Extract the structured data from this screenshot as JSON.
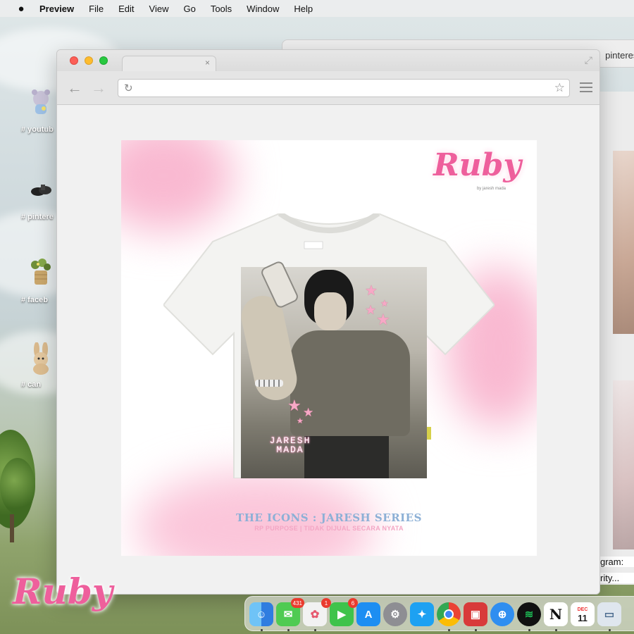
{
  "menubar": {
    "app_name": "Preview",
    "items": [
      "File",
      "Edit",
      "View",
      "Go",
      "Tools",
      "Window",
      "Help"
    ]
  },
  "desktop": {
    "icons": [
      {
        "label": "# youtub",
        "icon": "teddy-bear-sticker-icon"
      },
      {
        "label": "# pintere",
        "icon": "shoes-sticker-icon"
      },
      {
        "label": "# faceb",
        "icon": "flower-basket-sticker-icon"
      },
      {
        "label": "# can",
        "icon": "bunny-plush-sticker-icon"
      }
    ],
    "logo_text": "Ruby"
  },
  "background_window": {
    "url_fragment": "pinterest",
    "caption_line1": "gram:",
    "caption_line2": "rity..."
  },
  "browser": {
    "tab_close": "×",
    "omnibox_value": "",
    "omnibox_placeholder": ""
  },
  "poster": {
    "brand": "Ruby",
    "brand_sub": "by jaresh mada",
    "shirt_text_line1": "JARESH",
    "shirt_text_line2": "MADA",
    "title": "THE ICONS : JARESH SERIES",
    "subtitle": "RP PURPOSE | TIDAK DIJUAL SECARA NYATA"
  },
  "dock": {
    "apps": [
      {
        "name": "finder-icon",
        "color": "#3b8fe8",
        "glyph": "☺"
      },
      {
        "name": "messages-icon",
        "color": "#4fcb52",
        "glyph": "✉",
        "badge": "431"
      },
      {
        "name": "photos-icon",
        "color": "#f2f2f2",
        "glyph": "✿",
        "badge": "1"
      },
      {
        "name": "facetime-icon",
        "color": "#3fc34b",
        "glyph": "▶",
        "badge": "6"
      },
      {
        "name": "app-store-icon",
        "color": "#1d8ef2",
        "glyph": "A"
      },
      {
        "name": "system-preferences-icon",
        "color": "#8e8e93",
        "glyph": "⚙"
      },
      {
        "name": "twitter-icon",
        "color": "#1da1f2",
        "glyph": "✦"
      },
      {
        "name": "chrome-icon",
        "color": "#f2f2f2",
        "glyph": "◉"
      },
      {
        "name": "photo-booth-icon",
        "color": "#d83a3a",
        "glyph": "▣"
      },
      {
        "name": "safari-icon",
        "color": "#2f8ef0",
        "glyph": "⊕"
      },
      {
        "name": "spotify-icon",
        "color": "#1db954",
        "glyph": "≋"
      },
      {
        "name": "notion-icon",
        "color": "#ffffff",
        "glyph": "N"
      },
      {
        "name": "calendar-icon",
        "color": "#ffffff",
        "glyph": "11",
        "month": "DEC"
      },
      {
        "name": "preview-icon",
        "color": "#dfe6ee",
        "glyph": "▭"
      }
    ]
  }
}
